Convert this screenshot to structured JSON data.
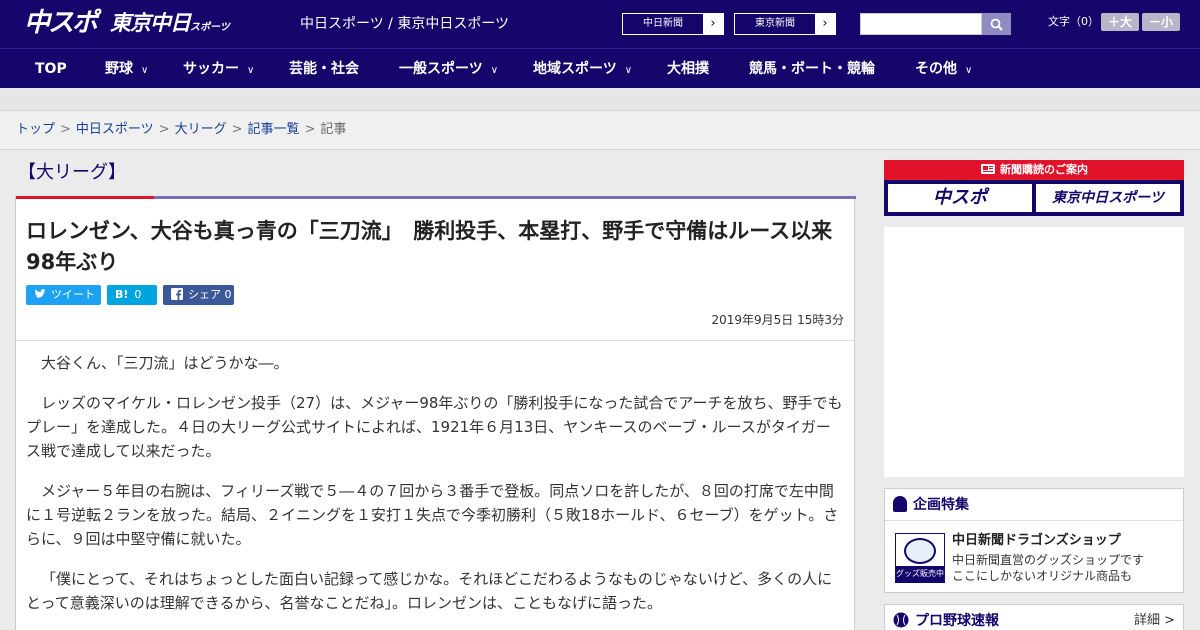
{
  "header": {
    "logo_chuspo": "中スポ",
    "logo_tokyo": "東京中日",
    "logo_tokyo_suffix": "スポーツ",
    "site_title": "中日スポーツ / 東京中日スポーツ",
    "btn_chunichi": "中日新聞",
    "btn_tokyo": "東京新聞",
    "arrow": "›",
    "search_placeholder": "",
    "search_icon": "search-icon",
    "fontsize_label": "文字（0）",
    "font_larger": "＋大",
    "font_smaller": "－小"
  },
  "nav": {
    "items": [
      {
        "label": "TOP",
        "has_menu": false
      },
      {
        "label": "野球",
        "has_menu": true
      },
      {
        "label": "サッカー",
        "has_menu": true
      },
      {
        "label": "芸能・社会",
        "has_menu": false
      },
      {
        "label": "一般スポーツ",
        "has_menu": true
      },
      {
        "label": "地域スポーツ",
        "has_menu": true
      },
      {
        "label": "大相撲",
        "has_menu": false
      },
      {
        "label": "競馬・ボート・競輪",
        "has_menu": false
      },
      {
        "label": "その他",
        "has_menu": true
      }
    ],
    "chevron": "∨"
  },
  "breadcrumb": {
    "items": [
      "トップ",
      "中日スポーツ",
      "大リーグ",
      "記事一覧"
    ],
    "current": "記事",
    "separator": ">"
  },
  "article": {
    "category": "【大リーグ】",
    "headline": "ロレンゼン、大谷も真っ青の「三刀流」　勝利投手、本塁打、野手で守備はルース以来98年ぶり",
    "share": {
      "tweet_label": "ツイート",
      "hatena_label": "B!",
      "hatena_count": "0",
      "facebook_label": "シェア",
      "facebook_count": "0"
    },
    "date": "2019年9月5日 15時3分",
    "paragraphs": [
      "大谷くん、「三刀流」はどうかな―。",
      "レッズのマイケル・ロレンゼン投手（27）は、メジャー98年ぶりの「勝利投手になった試合でアーチを放ち、野手でもプレー」を達成した。４日の大リーグ公式サイトによれば、1921年６月13日、ヤンキースのベーブ・ルースがタイガース戦で達成して以来だった。",
      "メジャー５年目の右腕は、フィリーズ戦で５―４の７回から３番手で登板。同点ソロを許したが、８回の打席で左中間に１号逆転２ランを放った。結局、２イニングを１安打１失点で今季初勝利（５敗18ホールド、６セーブ）をゲット。さらに、９回は中堅守備に就いた。",
      "「僕にとって、それはちょっとした面白い記録って感じかな。それほどこだわるようなものじゃないけど、多くの人にとって意義深いのは理解できるから、名誉なことだね」。ロレンゼンは、こともなげに語った。"
    ]
  },
  "sidebar": {
    "subscribe_header": "新聞購読のご案内",
    "subscribe_chuspo": "中スポ",
    "subscribe_tokyo": "東京中日スポーツ",
    "feature_title": "企画特集",
    "shop_title": "中日新聞ドラゴンズショップ",
    "shop_desc_1": "中日新聞直営のグッズショップです",
    "shop_desc_2": "ここにしかないオリジナル商品も",
    "shop_thumb_tag": "グッズ販売中",
    "baseball_title": "プロ野球速報",
    "detail_link": "詳細 >"
  },
  "colors": {
    "navy": "#14066b",
    "red": "#e0132a",
    "twitter": "#1da1f2",
    "hatena": "#00a4de",
    "facebook": "#3b5998"
  }
}
